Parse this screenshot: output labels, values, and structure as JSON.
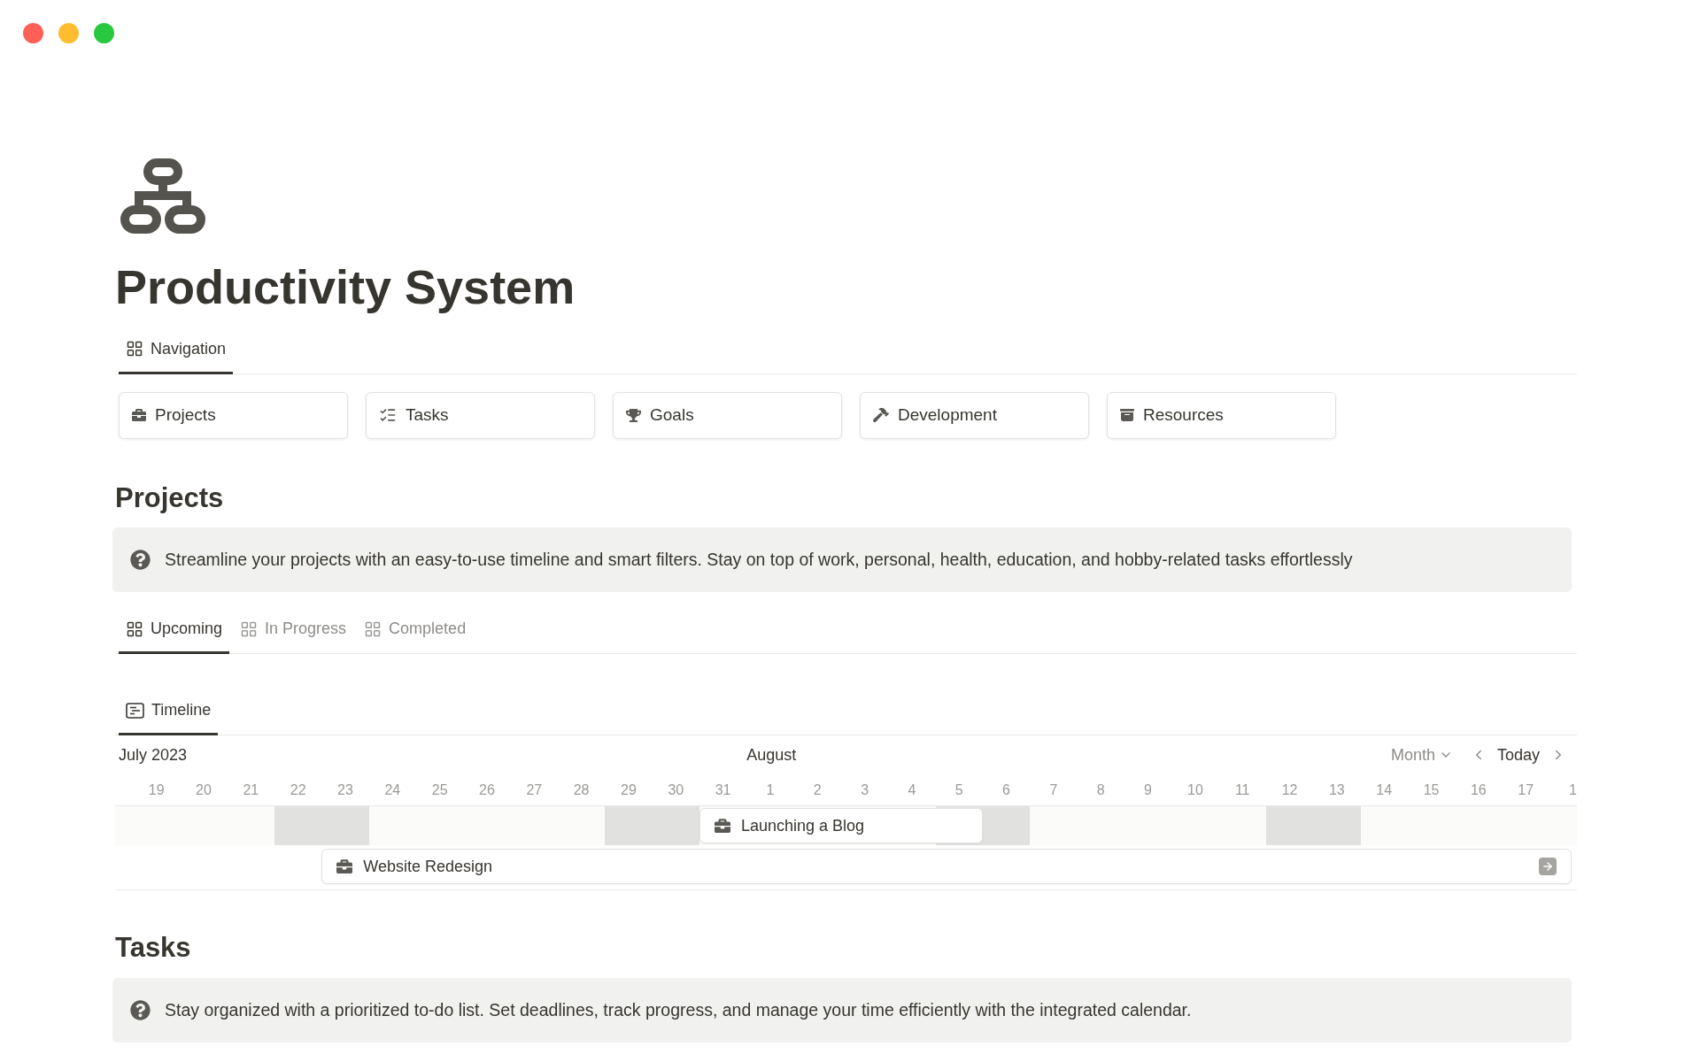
{
  "window": {
    "controls": [
      {
        "color": "#ff5f57"
      },
      {
        "color": "#febc2e"
      },
      {
        "color": "#28c840"
      }
    ]
  },
  "page": {
    "title": "Productivity System"
  },
  "navigation": {
    "tabs": [
      {
        "label": "Navigation",
        "selected": true
      }
    ],
    "buttons": [
      {
        "label": "Projects"
      },
      {
        "label": "Tasks"
      },
      {
        "label": "Goals"
      },
      {
        "label": "Development"
      },
      {
        "label": "Resources"
      }
    ]
  },
  "projects": {
    "heading": "Projects",
    "callout": "Streamline your projects with an easy-to-use timeline and smart filters. Stay on top of work, personal, health, education, and hobby-related tasks effortlessly",
    "view_tabs": [
      {
        "label": "Upcoming",
        "selected": true
      },
      {
        "label": "In Progress",
        "selected": false
      },
      {
        "label": "Completed",
        "selected": false
      }
    ],
    "layout_tabs": [
      {
        "label": "Timeline",
        "selected": true
      }
    ],
    "timeline": {
      "month_left": "July 2023",
      "month_right": "August",
      "scale": "Month",
      "today": "Today",
      "days": [
        {
          "label": "19",
          "weekend": false
        },
        {
          "label": "20",
          "weekend": false
        },
        {
          "label": "21",
          "weekend": false
        },
        {
          "label": "22",
          "weekend": true
        },
        {
          "label": "23",
          "weekend": true
        },
        {
          "label": "24",
          "weekend": false
        },
        {
          "label": "25",
          "weekend": false
        },
        {
          "label": "26",
          "weekend": false
        },
        {
          "label": "27",
          "weekend": false
        },
        {
          "label": "28",
          "weekend": false
        },
        {
          "label": "29",
          "weekend": true
        },
        {
          "label": "30",
          "weekend": true
        },
        {
          "label": "31",
          "weekend": false
        },
        {
          "label": "1",
          "weekend": false
        },
        {
          "label": "2",
          "weekend": false
        },
        {
          "label": "3",
          "weekend": false
        },
        {
          "label": "4",
          "weekend": false
        },
        {
          "label": "5",
          "weekend": true
        },
        {
          "label": "6",
          "weekend": true
        },
        {
          "label": "7",
          "weekend": false
        },
        {
          "label": "8",
          "weekend": false
        },
        {
          "label": "9",
          "weekend": false
        },
        {
          "label": "10",
          "weekend": false
        },
        {
          "label": "11",
          "weekend": false
        },
        {
          "label": "12",
          "weekend": true
        },
        {
          "label": "13",
          "weekend": true
        },
        {
          "label": "14",
          "weekend": false
        },
        {
          "label": "15",
          "weekend": false
        },
        {
          "label": "16",
          "weekend": false
        },
        {
          "label": "17",
          "weekend": false
        },
        {
          "label": "1",
          "weekend": false
        }
      ],
      "items": [
        {
          "title": "Launching a Blog"
        },
        {
          "title": "Website Redesign"
        }
      ]
    }
  },
  "tasks": {
    "heading": "Tasks",
    "callout": "Stay organized with a prioritized to-do list. Set deadlines, track progress, and manage your time efficiently with the integrated calendar."
  }
}
